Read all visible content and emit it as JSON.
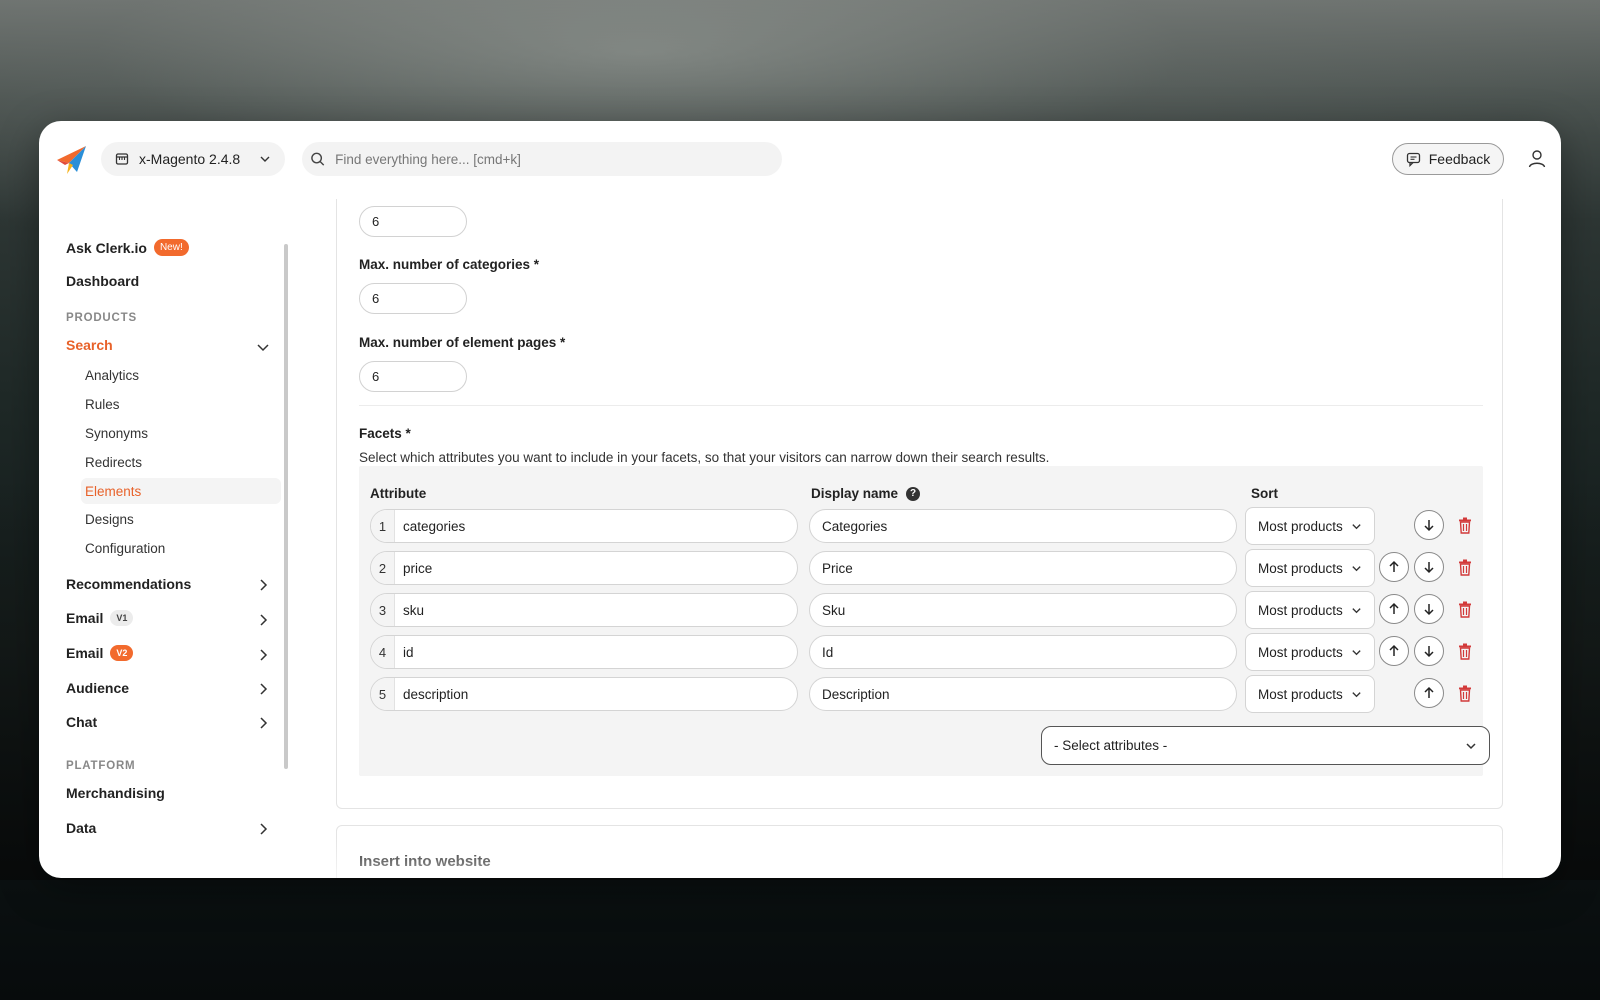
{
  "header": {
    "store_name": "x-Magento 2.4.8",
    "search_placeholder": "Find everything here... [cmd+k]",
    "feedback_label": "Feedback"
  },
  "sidebar": {
    "ask_label": "Ask Clerk.io",
    "ask_badge": "New!",
    "dashboard": "Dashboard",
    "products_section": "PRODUCTS",
    "search": "Search",
    "search_sub": [
      "Analytics",
      "Rules",
      "Synonyms",
      "Redirects",
      "Elements",
      "Designs",
      "Configuration"
    ],
    "active_sub": "Elements",
    "recommendations": "Recommendations",
    "email_v1": "Email",
    "email_v1_badge": "V1",
    "email_v2": "Email",
    "email_v2_badge": "V2",
    "audience": "Audience",
    "chat": "Chat",
    "platform_section": "PLATFORM",
    "merchandising": "Merchandising",
    "data": "Data"
  },
  "settings": {
    "top_value": "6",
    "max_categories_label": "Max. number of categories *",
    "max_categories_value": "6",
    "max_pages_label": "Max. number of element pages *",
    "max_pages_value": "6"
  },
  "facets": {
    "title": "Facets *",
    "description": "Select which attributes you want to include in your facets, so that your visitors can narrow down their search results.",
    "col_attribute": "Attribute",
    "col_display": "Display name",
    "col_sort": "Sort",
    "rows": [
      {
        "num": "1",
        "attribute": "categories",
        "display": "Categories",
        "sort": "Most products"
      },
      {
        "num": "2",
        "attribute": "price",
        "display": "Price",
        "sort": "Most products"
      },
      {
        "num": "3",
        "attribute": "sku",
        "display": "Sku",
        "sort": "Most products"
      },
      {
        "num": "4",
        "attribute": "id",
        "display": "Id",
        "sort": "Most products"
      },
      {
        "num": "5",
        "attribute": "description",
        "display": "Description",
        "sort": "Most products"
      }
    ],
    "select_placeholder": "- Select attributes -"
  },
  "insert_card": {
    "title": "Insert into website"
  },
  "colors": {
    "accent": "#e8622a",
    "trash": "#d23a3a"
  }
}
